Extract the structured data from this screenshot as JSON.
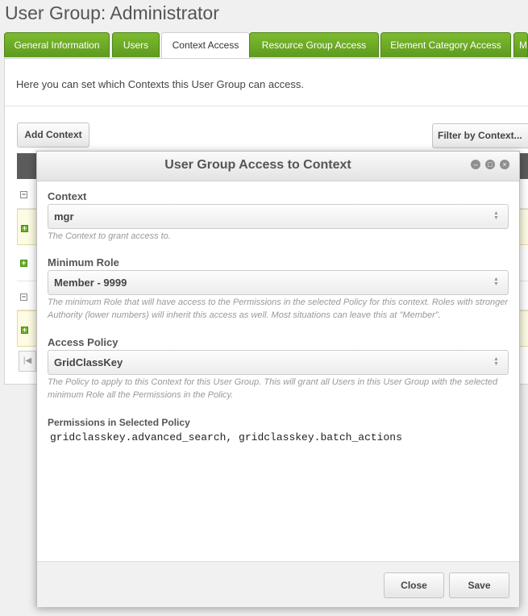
{
  "page": {
    "title": "User Group: Administrator"
  },
  "tabs": [
    {
      "label": "General Information"
    },
    {
      "label": "Users"
    },
    {
      "label": "Context Access"
    },
    {
      "label": "Resource Group Access"
    },
    {
      "label": "Element Category Access"
    },
    {
      "label": "M"
    }
  ],
  "intro": "Here you can set which Contexts this User Group can access.",
  "toolbar": {
    "add_context": "Add Context",
    "filter_context": "Filter by Context..."
  },
  "modal": {
    "title": "User Group Access to Context",
    "context": {
      "label": "Context",
      "value": "mgr",
      "hint": "The Context to grant access to."
    },
    "minimum_role": {
      "label": "Minimum Role",
      "value": "Member - 9999",
      "hint": "The minimum Role that will have access to the Permissions in the selected Policy for this context. Roles with stronger Authority (lower numbers) will inherit this access as well. Most situations can leave this at \"Member\"."
    },
    "access_policy": {
      "label": "Access Policy",
      "value": "GridClassKey",
      "hint": "The Policy to apply to this Context for this User Group. This will grant all Users in this User Group with the selected minimum Role all the Permissions in the Policy."
    },
    "permissions": {
      "label": "Permissions in Selected Policy",
      "value": "gridclasskey.advanced_search, gridclasskey.batch_actions"
    },
    "close_label": "Close",
    "save_label": "Save"
  },
  "colors": {
    "tab_green": "#6aa92a",
    "header_dark": "#5b5b5b"
  }
}
